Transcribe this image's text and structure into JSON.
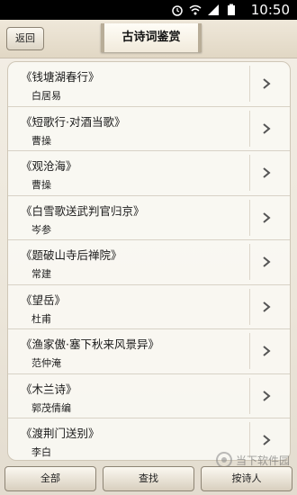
{
  "status_bar": {
    "time": "10:50",
    "icons": [
      "alarm-icon",
      "wifi-icon",
      "signal-icon",
      "battery-icon"
    ]
  },
  "header": {
    "back_label": "返回",
    "title": "古诗词鉴赏"
  },
  "poems": [
    {
      "title": "《钱塘湖春行》",
      "author": "白居易"
    },
    {
      "title": "《短歌行·对酒当歌》",
      "author": "曹操"
    },
    {
      "title": "《观沧海》",
      "author": "曹操"
    },
    {
      "title": "《白雪歌送武判官归京》",
      "author": "岑参"
    },
    {
      "title": "《题破山寺后禅院》",
      "author": "常建"
    },
    {
      "title": "《望岳》",
      "author": "杜甫"
    },
    {
      "title": "《渔家傲·塞下秋来风景异》",
      "author": "范仲淹"
    },
    {
      "title": "《木兰诗》",
      "author": "郭茂倩编"
    },
    {
      "title": "《渡荆门送别》",
      "author": "李白"
    }
  ],
  "bottom_bar": {
    "all_label": "全部",
    "search_label": "查找",
    "by_poet_label": "按诗人"
  },
  "watermark": {
    "text": "当下软件园"
  }
}
